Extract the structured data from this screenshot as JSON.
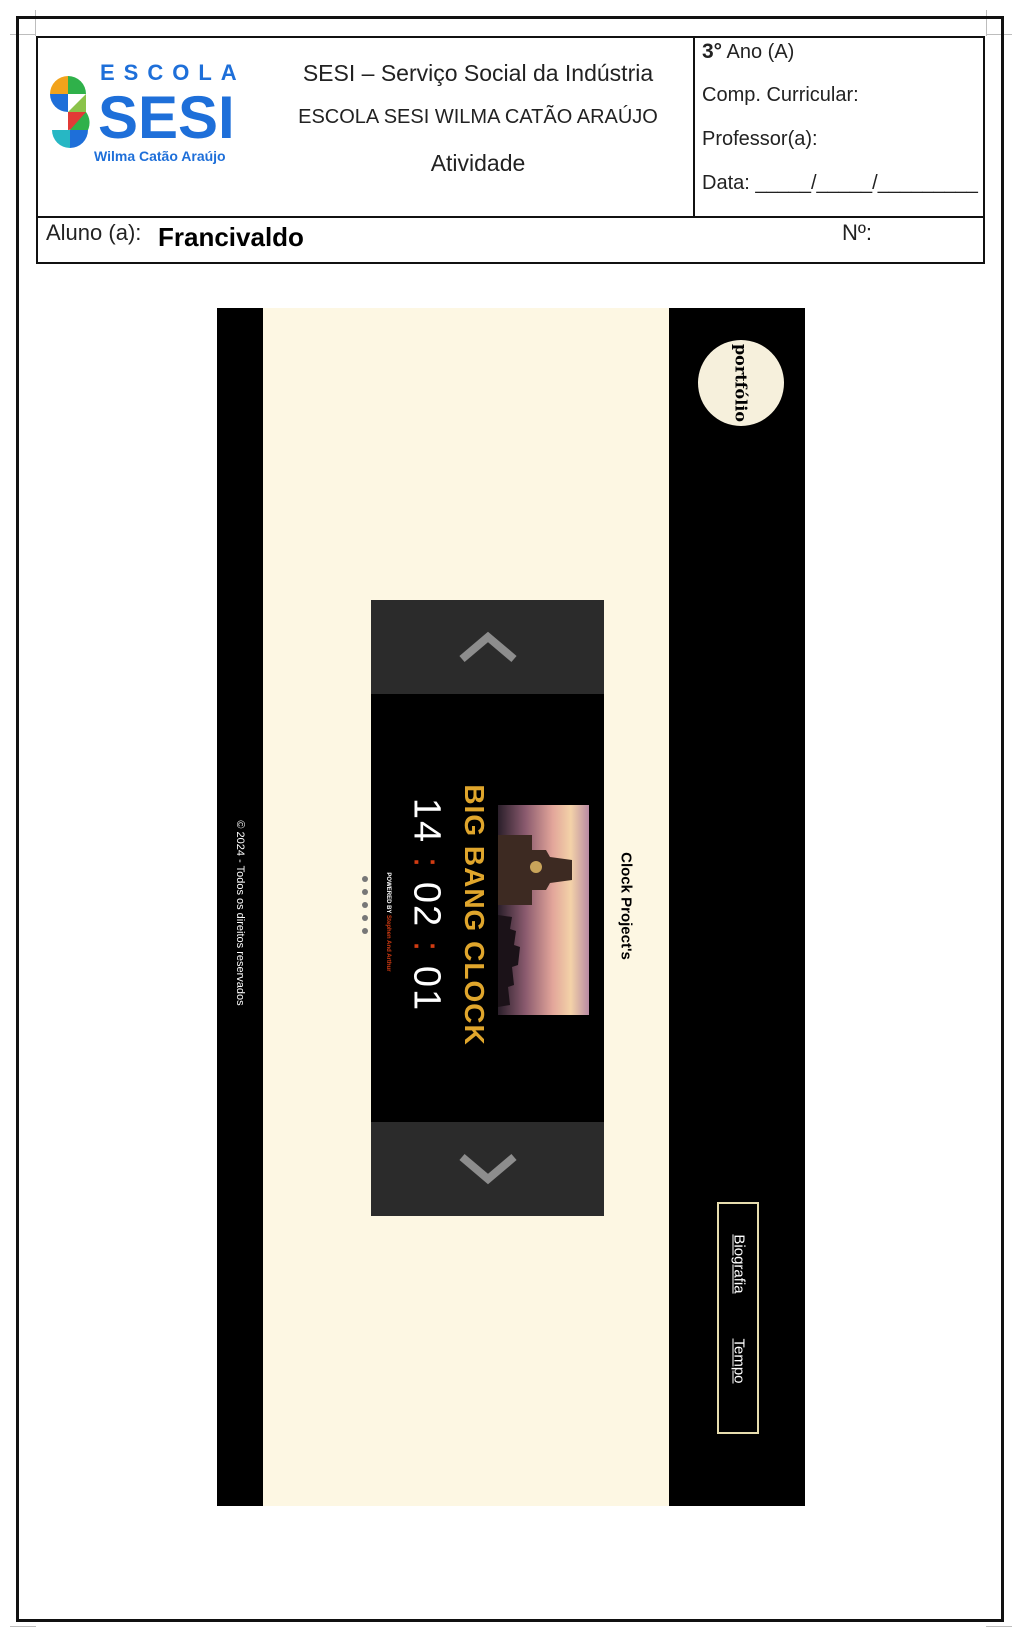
{
  "header": {
    "logo_top": "ESCOLA",
    "logo_main": "SESI",
    "logo_sub": "Wilma Catão Araújo",
    "institution": "SESI – Serviço Social da Indústria",
    "school": "ESCOLA SESI WILMA CATÃO ARAÚJO",
    "doc_type": "Atividade",
    "grade_number": "3°",
    "grade_rest": "Ano (A)",
    "component": "Comp. Curricular:",
    "teacher": "Professor(a):",
    "date": "Data: _____/_____/_________",
    "student_label": "Aluno (a):",
    "student_name": "Francivaldo",
    "number_label": "Nº:"
  },
  "screenshot": {
    "portfolio": "portfólio",
    "copyright": "© 2024 - Todos os direitos reservados",
    "clock_title": "BIG BANG CLOCK",
    "hours": "14",
    "minutes": "02",
    "seconds": "01",
    "separator": ":",
    "powered_prefix": "POWERED BY",
    "powered_by": "Stephen And Arthur",
    "section_title": "Clock Project's",
    "nav": [
      "Biografia",
      "Tempo"
    ],
    "colors": {
      "clock_title": "#e0a62c",
      "separator": "#d23c12",
      "background": "#fdf7e3"
    }
  }
}
